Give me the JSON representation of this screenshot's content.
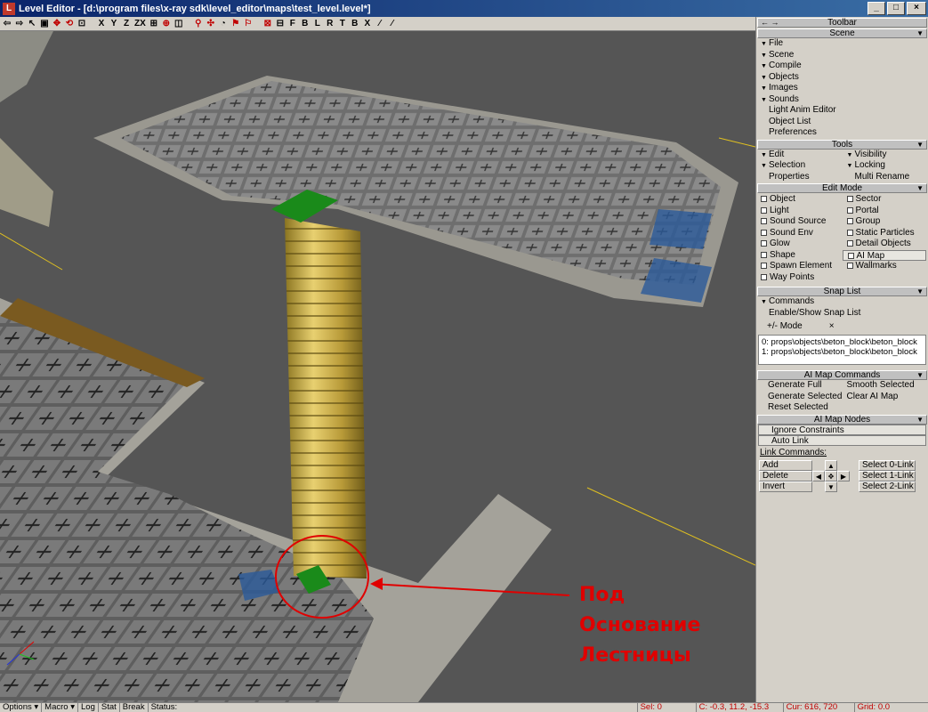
{
  "window": {
    "title": "Level Editor - [d:\\program files\\x-ray sdk\\level_editor\\maps\\test_level.level*]",
    "app_icon": "L",
    "buttons": [
      "minimize-icon",
      "maximize-icon",
      "close-icon"
    ]
  },
  "toolbar": {
    "letters": [
      "X",
      "Y",
      "Z",
      "ZX",
      "F",
      "B",
      "L",
      "R",
      "T",
      "B",
      "X"
    ],
    "icons": [
      "undo-icon",
      "redo-icon",
      "select-icon",
      "move-icon",
      "rotate-icon",
      "scale-icon"
    ]
  },
  "panel": {
    "header": "Toolbar",
    "header_left": "← →",
    "scene": {
      "title": "Scene",
      "menus": [
        "File",
        "Scene",
        "Compile",
        "Objects",
        "Images",
        "Sounds"
      ],
      "links": [
        "Light Anim Editor",
        "Object List",
        "Preferences"
      ]
    },
    "tools": {
      "title": "Tools",
      "left": [
        "Edit",
        "Selection",
        "Properties"
      ],
      "right": [
        "Visibility",
        "Locking",
        "Multi Rename"
      ]
    },
    "edit_mode": {
      "title": "Edit Mode",
      "left": [
        "Object",
        "Light",
        "Sound Source",
        "Sound Env",
        "Glow",
        "Shape",
        "Spawn Element",
        "Way Points"
      ],
      "right": [
        "Sector",
        "Portal",
        "Group",
        "Static Particles",
        "Detail Objects",
        "AI Map",
        "Wallmarks"
      ]
    },
    "snap_list": {
      "title": "Snap List",
      "commands_label": "Commands",
      "enable_label": "Enable/Show Snap List",
      "mode_label": "+/- Mode",
      "clear_label": "×",
      "entries": [
        "0: props\\objects\\beton_block\\beton_block",
        "1: props\\objects\\beton_block\\beton_block"
      ]
    },
    "ai_commands": {
      "title": "AI Map Commands",
      "left": [
        "Generate Full",
        "Generate Selected",
        "Reset Selected"
      ],
      "right": [
        "Smooth Selected",
        "Clear AI Map"
      ]
    },
    "ai_nodes": {
      "title": "AI Map Nodes",
      "ignore_label": "Ignore Constraints",
      "auto_link_label": "Auto Link",
      "link_commands_label": "Link Commands:",
      "link_ops": [
        "Add",
        "Delete",
        "Invert"
      ],
      "select_links": [
        "Select 0-Link",
        "Select 1-Link",
        "Select 2-Link"
      ]
    }
  },
  "annotation": {
    "lines": [
      "Под",
      "Основание",
      "Лестницы"
    ],
    "color": "#e00000"
  },
  "statusbar": {
    "options": "Options",
    "macro": "Macro",
    "log": "Log",
    "stat": "Stat",
    "break": "Break",
    "status": "Status:",
    "sel": "Sel: 0",
    "coords": "C: -0.3, 11.2, -15.3",
    "cursor": "Cur: 616, 720",
    "grid": "Grid: 0.0"
  }
}
